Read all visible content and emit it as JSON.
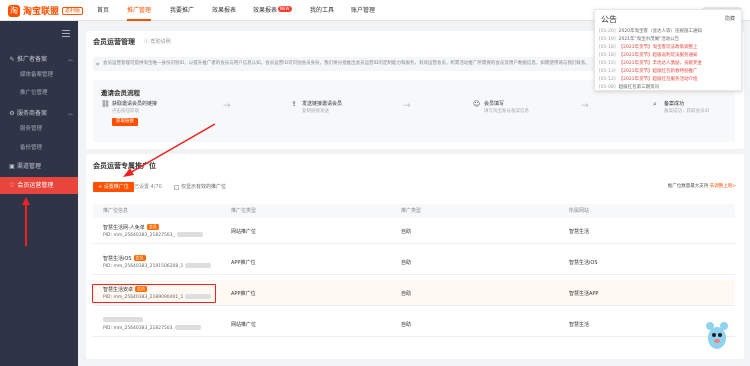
{
  "header": {
    "logo_mark": "淘",
    "logo_text": "淘宝联盟",
    "logo_tag": "返利版",
    "nav": [
      {
        "label": "首页",
        "active": false,
        "badge": ""
      },
      {
        "label": "推广管理",
        "active": true,
        "badge": ""
      },
      {
        "label": "我要推广",
        "active": false,
        "badge": ""
      },
      {
        "label": "效果报表",
        "active": false,
        "badge": ""
      },
      {
        "label": "效果报表",
        "active": false,
        "badge": "NEW"
      },
      {
        "label": "我的工具",
        "active": false,
        "badge": ""
      },
      {
        "label": "账户管理",
        "active": false,
        "badge": ""
      }
    ]
  },
  "sidebar": {
    "groups": [
      {
        "label": "推广者备案",
        "icon": "bookmark-icon",
        "glyph": "✎"
      },
      {
        "label": "媒体备案管理"
      },
      {
        "label": "推广位管理"
      },
      {
        "label": "服务商备案",
        "icon": "service-icon",
        "glyph": "⚙"
      },
      {
        "label": "服务管理"
      },
      {
        "label": "备份管理"
      },
      {
        "label": "渠道管理",
        "icon": "channel-icon",
        "glyph": "▣"
      }
    ],
    "active": {
      "label": "会员运营管理",
      "glyph": "♡"
    }
  },
  "page": {
    "title": "会员运营管理",
    "help": "帮助说明",
    "notice": "会员运营管理可提供淘宝唯一身份识别ID，以提升推广者的会员与用户信息认知，会员运营ID可识别会员身份，我们将分批推出会员运营ID的定制能力和服务，有效运营会员，积累活动推广所需要的会员及用户数据信息，如需使用请与我们联系。",
    "process": {
      "title": "邀请会员流程",
      "steps": [
        {
          "icon": "link-icon",
          "glyph": "⛓",
          "title": "获取邀请会员的链接",
          "desc": "点击按钮获取",
          "button": "获取链接"
        },
        {
          "icon": "share-icon",
          "glyph": "⇪",
          "title": "发送链接邀请会员",
          "desc": "复制链接发送"
        },
        {
          "icon": "member-icon",
          "glyph": "☺",
          "title": "会员填写",
          "desc": "填写淘宝账号备案信息"
        },
        {
          "icon": "search-icon",
          "glyph": "⌕",
          "title": "备案成功",
          "desc": "备案成功，获取会员ID"
        }
      ]
    },
    "table_card": {
      "title": "会员运营专属推广位",
      "add_button": "+ 设置推广位",
      "created": "已设置 4/70",
      "checkbox_label": "仅显示有效的推广位",
      "quota_text": "推广位数量最大支持",
      "quota_link": "去调整上限>",
      "columns": [
        "推广位信息",
        "推广位类型",
        "推广类型",
        "所属网站"
      ],
      "rows": [
        {
          "name": "智慧生活网-人免单",
          "tag": "会员",
          "pid": "PID: mm_25640383_21827503_",
          "type": "网站推广位",
          "promo": "自助",
          "site": "智慧生活",
          "highlight": false
        },
        {
          "name": "智慧生活iOS",
          "tag": "会员",
          "pid": "PID: mm_25640383_2191506208_1",
          "type": "APP推广位",
          "promo": "自助",
          "site": "智慧生活iOS",
          "highlight": false
        },
        {
          "name": "智慧生活安卓",
          "tag": "会员",
          "pid": "PID: mm_25640383_2189090401_1",
          "type": "APP推广位",
          "promo": "自助",
          "site": "智慧生活APP",
          "highlight": true
        },
        {
          "name": "",
          "tag": "",
          "pid": "PID: mm_25640383_21827503",
          "type": "网站推广位",
          "promo": "自助",
          "site": "智慧生活",
          "highlight": false
        }
      ]
    }
  },
  "announcement": {
    "title": "公告",
    "hide_label": "隐藏",
    "items": [
      {
        "date": "[01-20]",
        "text": "2020年淘宝客（含达人等）违规施工通知",
        "hot": false
      },
      {
        "date": "[01-19]",
        "text": "2021年\"淘宝巾茂阁\"活动公告",
        "hot": false
      },
      {
        "date": "[01-18]",
        "text": "【2021年货节】淘宝客玩法政策调整上",
        "hot": true
      },
      {
        "date": "[01-18]",
        "text": "【2021年货节】超级返利玩法服务通知",
        "hot": true
      },
      {
        "date": "[01-15]",
        "text": "【2021年货节】丰优达人激励，贡献奖金",
        "hot": true
      },
      {
        "date": "[01-13]",
        "text": "【2021年货节】超级红包新春特别推广",
        "hot": true
      },
      {
        "date": "[01-12]",
        "text": "【2021年货节】超级红包服务活动介绍",
        "hot": true
      },
      {
        "date": "[01-08]",
        "text": "超级红包第三期资讯",
        "hot": false
      }
    ]
  },
  "colors": {
    "accent": "#ff5000",
    "sidebar": "#2f3446",
    "active": "#e8453c",
    "annotation": "#e22222"
  }
}
